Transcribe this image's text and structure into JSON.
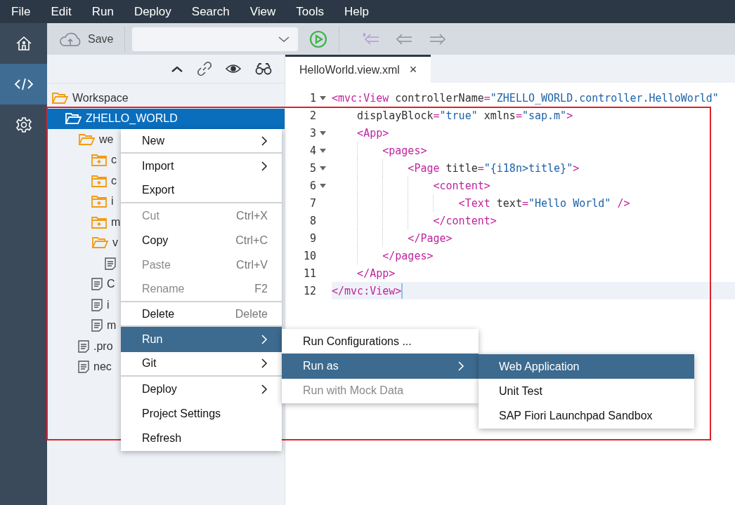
{
  "menubar": [
    "File",
    "Edit",
    "Run",
    "Deploy",
    "Search",
    "View",
    "Tools",
    "Help"
  ],
  "rail": [
    {
      "kind": "home",
      "selected": false
    },
    {
      "kind": "code",
      "selected": true
    },
    {
      "kind": "settings",
      "selected": false
    }
  ],
  "toolbar": {
    "save": "Save"
  },
  "tree": [
    {
      "label": "Workspace",
      "kind": "folder",
      "expanded": true,
      "selected": false,
      "children": [
        {
          "label": "ZHELLO_WORLD",
          "kind": "folder",
          "expanded": true,
          "selected": true,
          "children": [
            {
              "label": "we",
              "kind": "folder",
              "expanded": true,
              "selected": false,
              "children": [
                {
                  "label": "c",
                  "kind": "folder",
                  "expanded": false,
                  "selected": false
                },
                {
                  "label": "c",
                  "kind": "folder",
                  "expanded": false,
                  "selected": false
                },
                {
                  "label": "i",
                  "kind": "folder",
                  "expanded": false,
                  "selected": false
                },
                {
                  "label": "m",
                  "kind": "folder",
                  "expanded": false,
                  "selected": false
                },
                {
                  "label": "v",
                  "kind": "folder",
                  "expanded": true,
                  "selected": false,
                  "children": [
                    {
                      "kind": "file",
                      "selected": false
                    }
                  ]
                },
                {
                  "label": "C",
                  "kind": "file",
                  "selected": false
                },
                {
                  "label": "i",
                  "kind": "file",
                  "selected": false
                },
                {
                  "label": "m",
                  "kind": "file",
                  "selected": false
                }
              ]
            },
            {
              "label": ".pro",
              "kind": "file",
              "selected": false
            },
            {
              "label": "nec",
              "kind": "file",
              "selected": false
            }
          ]
        }
      ]
    }
  ],
  "tab": {
    "label": "HelloWorld.view.xml",
    "close": "×",
    "selected": true
  },
  "code": [
    {
      "number": "1",
      "foldable": true,
      "current": false,
      "tokens": [
        {
          "kind": "tag",
          "text": "<mvc:View"
        },
        {
          "kind": "attr",
          "text": " controllerName"
        },
        {
          "kind": "tag",
          "text": "="
        },
        {
          "kind": "str",
          "text": "\"ZHELLO_WORLD.controller.HelloWorld\""
        }
      ]
    },
    {
      "number": "2",
      "foldable": false,
      "current": false,
      "tokens": [
        {
          "kind": "attr",
          "text": "    displayBlock"
        },
        {
          "kind": "tag",
          "text": "="
        },
        {
          "kind": "str",
          "text": "\"true\""
        },
        {
          "kind": "attr",
          "text": " xmlns"
        },
        {
          "kind": "tag",
          "text": "="
        },
        {
          "kind": "str",
          "text": "\"sap.m\""
        },
        {
          "kind": "tag",
          "text": ">"
        }
      ]
    },
    {
      "number": "3",
      "foldable": true,
      "current": false,
      "tokens": [
        {
          "kind": "tag",
          "text": "    <App>"
        }
      ]
    },
    {
      "number": "4",
      "foldable": true,
      "current": false,
      "tokens": [
        {
          "kind": "tag",
          "text": "        <pages>"
        }
      ]
    },
    {
      "number": "5",
      "foldable": true,
      "current": false,
      "tokens": [
        {
          "kind": "tag",
          "text": "            <Page"
        },
        {
          "kind": "attr",
          "text": " title"
        },
        {
          "kind": "tag",
          "text": "="
        },
        {
          "kind": "str",
          "text": "\"{i18n>title}\""
        },
        {
          "kind": "tag",
          "text": ">"
        }
      ]
    },
    {
      "number": "6",
      "foldable": true,
      "current": false,
      "tokens": [
        {
          "kind": "tag",
          "text": "                <content>"
        }
      ]
    },
    {
      "number": "7",
      "foldable": false,
      "current": false,
      "tokens": [
        {
          "kind": "tag",
          "text": "                    <Text"
        },
        {
          "kind": "attr",
          "text": " text"
        },
        {
          "kind": "tag",
          "text": "="
        },
        {
          "kind": "str",
          "text": "\"Hello World\""
        },
        {
          "kind": "tag",
          "text": " />"
        }
      ]
    },
    {
      "number": "8",
      "foldable": false,
      "current": false,
      "tokens": [
        {
          "kind": "tag",
          "text": "                </content>"
        }
      ]
    },
    {
      "number": "9",
      "foldable": false,
      "current": false,
      "tokens": [
        {
          "kind": "tag",
          "text": "            </Page>"
        }
      ]
    },
    {
      "number": "10",
      "foldable": false,
      "current": false,
      "tokens": [
        {
          "kind": "tag",
          "text": "        </pages>"
        }
      ]
    },
    {
      "number": "11",
      "foldable": false,
      "current": false,
      "tokens": [
        {
          "kind": "tag",
          "text": "    </App>"
        }
      ]
    },
    {
      "number": "12",
      "foldable": false,
      "current": true,
      "tokens": [
        {
          "kind": "tag",
          "text": "</mvc:View>"
        }
      ]
    }
  ],
  "context_menu": [
    {
      "label": "New",
      "submenu": true,
      "disabled": false,
      "selected": false,
      "separator_after": true
    },
    {
      "label": "Import",
      "submenu": true,
      "disabled": false,
      "selected": false,
      "separator_after": false
    },
    {
      "label": "Export",
      "submenu": false,
      "disabled": false,
      "selected": false,
      "separator_after": true
    },
    {
      "label": "Cut",
      "shortcut": "Ctrl+X",
      "submenu": false,
      "disabled": true,
      "selected": false,
      "separator_after": false
    },
    {
      "label": "Copy",
      "shortcut": "Ctrl+C",
      "submenu": false,
      "disabled": false,
      "selected": false,
      "separator_after": false
    },
    {
      "label": "Paste",
      "shortcut": "Ctrl+V",
      "submenu": false,
      "disabled": true,
      "selected": false,
      "separator_after": false
    },
    {
      "label": "Rename",
      "shortcut": "F2",
      "submenu": false,
      "disabled": true,
      "selected": false,
      "separator_after": true
    },
    {
      "label": "Delete",
      "shortcut": "Delete",
      "submenu": false,
      "disabled": false,
      "selected": false,
      "separator_after": true
    },
    {
      "label": "Run",
      "submenu": true,
      "disabled": false,
      "selected": true,
      "separator_after": false
    },
    {
      "label": "Git",
      "submenu": true,
      "disabled": false,
      "selected": false,
      "separator_after": true
    },
    {
      "label": "Deploy",
      "submenu": true,
      "disabled": false,
      "selected": false,
      "separator_after": false
    },
    {
      "label": "Project Settings",
      "submenu": false,
      "disabled": false,
      "selected": false,
      "separator_after": false
    },
    {
      "label": "Refresh",
      "submenu": false,
      "disabled": false,
      "selected": false,
      "separator_after": false
    }
  ],
  "run_menu": [
    {
      "label": "Run Configurations ...",
      "submenu": false,
      "disabled": false,
      "selected": false
    },
    {
      "label": "Run as",
      "submenu": true,
      "disabled": false,
      "selected": true
    },
    {
      "label": "Run with Mock Data",
      "submenu": false,
      "disabled": true,
      "selected": false
    }
  ],
  "run_as_menu": [
    {
      "label": "Web Application",
      "selected": true
    },
    {
      "label": "Unit Test",
      "selected": false
    },
    {
      "label": "SAP Fiori Launchpad Sandbox",
      "selected": false
    }
  ]
}
